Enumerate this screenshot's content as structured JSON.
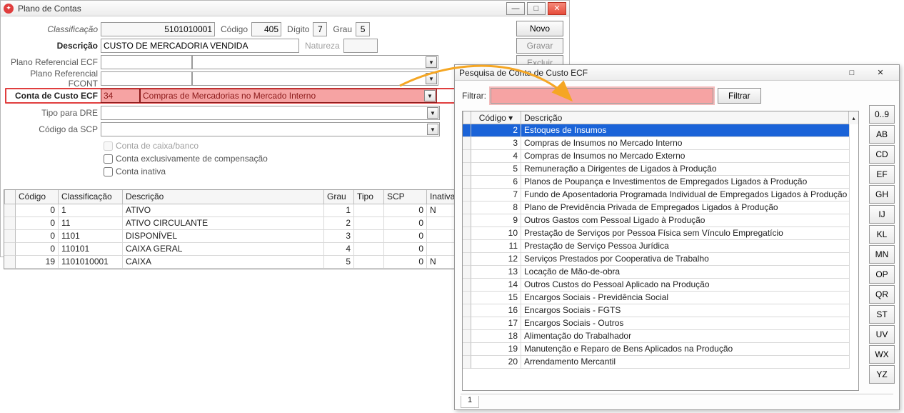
{
  "main": {
    "title": "Plano de Contas",
    "fields": {
      "classificacao": {
        "label": "Classificação",
        "value": "5101010001"
      },
      "codigo": {
        "label": "Código",
        "value": "405"
      },
      "digito": {
        "label": "Dígito",
        "value": "7"
      },
      "grau": {
        "label": "Grau",
        "value": "5"
      },
      "descricao": {
        "label": "Descrição",
        "value": "CUSTO DE MERCADORIA VENDIDA"
      },
      "natureza": {
        "label": "Natureza",
        "value": ""
      },
      "plano_ecf": {
        "label": "Plano Referencial ECF",
        "value": ""
      },
      "plano_fcont": {
        "label": "Plano Referencial FCONT",
        "value": ""
      },
      "conta_custo_ecf_code": {
        "label": "Conta de Custo ECF",
        "value": "34"
      },
      "conta_custo_ecf_desc": "Compras de Mercadorias no Mercado Interno",
      "tipo_dre": {
        "label": "Tipo para DRE",
        "value": ""
      },
      "codigo_scp": {
        "label": "Código da SCP",
        "value": ""
      }
    },
    "checkboxes": {
      "conta_caixa_banco": {
        "label": "Conta de caixa/banco",
        "checked": false,
        "disabled": true
      },
      "conta_compensacao": {
        "label": "Conta exclusivamente de compensação",
        "checked": false,
        "disabled": false
      },
      "conta_inativa": {
        "label": "Conta inativa",
        "checked": false,
        "disabled": false
      }
    },
    "sidebuttons": {
      "novo": {
        "label": "Novo"
      },
      "gravar": {
        "label": "Gravar"
      },
      "excluir": {
        "label": "Excluir"
      }
    },
    "grid": {
      "headers": [
        "Código",
        "Classificação",
        "Descrição",
        "Grau",
        "Tipo",
        "SCP",
        "Inativa"
      ],
      "rows": [
        {
          "codigo": "0",
          "classif": "1",
          "desc": "ATIVO",
          "grau": "1",
          "tipo": "",
          "scp": "0",
          "inativa": "N"
        },
        {
          "codigo": "0",
          "classif": "11",
          "desc": "ATIVO CIRCULANTE",
          "grau": "2",
          "tipo": "",
          "scp": "0",
          "inativa": ""
        },
        {
          "codigo": "0",
          "classif": "1101",
          "desc": "DISPONÍVEL",
          "grau": "3",
          "tipo": "",
          "scp": "0",
          "inativa": ""
        },
        {
          "codigo": "0",
          "classif": "110101",
          "desc": "CAIXA GERAL",
          "grau": "4",
          "tipo": "",
          "scp": "0",
          "inativa": ""
        },
        {
          "codigo": "19",
          "classif": "1101010001",
          "desc": "CAIXA",
          "grau": "5",
          "tipo": "",
          "scp": "0",
          "inativa": "N"
        }
      ]
    }
  },
  "dialog": {
    "title": "Pesquisa de Conta de Custo ECF",
    "filter_label": "Filtrar:",
    "filter_value": "",
    "filter_button": "Filtrar",
    "headers": {
      "codigo": "Código",
      "descricao": "Descrição"
    },
    "rows": [
      {
        "codigo": "2",
        "desc": "Estoques de Insumos",
        "selected": true
      },
      {
        "codigo": "3",
        "desc": "Compras de Insumos no Mercado Interno"
      },
      {
        "codigo": "4",
        "desc": "Compras de Insumos no Mercado Externo"
      },
      {
        "codigo": "5",
        "desc": "Remuneração a Dirigentes de Ligados à Produção"
      },
      {
        "codigo": "6",
        "desc": "Planos de Poupança e Investimentos de Empregados Ligados à Produção"
      },
      {
        "codigo": "7",
        "desc": "Fundo de Aposentadoria Programada Individual de Empregados Ligados à Produção"
      },
      {
        "codigo": "8",
        "desc": "Plano de Previdência Privada de Empregados Ligados à Produção"
      },
      {
        "codigo": "9",
        "desc": "Outros Gastos com Pessoal Ligado à Produção"
      },
      {
        "codigo": "10",
        "desc": "Prestação de Serviços por Pessoa Física sem Vínculo Empregatício"
      },
      {
        "codigo": "11",
        "desc": "Prestação de Serviço Pessoa Jurídica"
      },
      {
        "codigo": "12",
        "desc": "Serviços Prestados por Cooperativa de Trabalho"
      },
      {
        "codigo": "13",
        "desc": "Locação de Mão-de-obra"
      },
      {
        "codigo": "14",
        "desc": "Outros Custos do Pessoal Aplicado na Produção"
      },
      {
        "codigo": "15",
        "desc": "Encargos Sociais - Previdência Social"
      },
      {
        "codigo": "16",
        "desc": "Encargos Sociais - FGTS"
      },
      {
        "codigo": "17",
        "desc": "Encargos Sociais - Outros"
      },
      {
        "codigo": "18",
        "desc": "Alimentação do Trabalhador"
      },
      {
        "codigo": "19",
        "desc": "Manutenção e Reparo de Bens Aplicados na Produção"
      },
      {
        "codigo": "20",
        "desc": "Arrendamento Mercantil"
      }
    ],
    "alpha_buttons": [
      "0..9",
      "AB",
      "CD",
      "EF",
      "GH",
      "IJ",
      "KL",
      "MN",
      "OP",
      "QR",
      "ST",
      "UV",
      "WX",
      "YZ"
    ],
    "tab_label": "1"
  }
}
